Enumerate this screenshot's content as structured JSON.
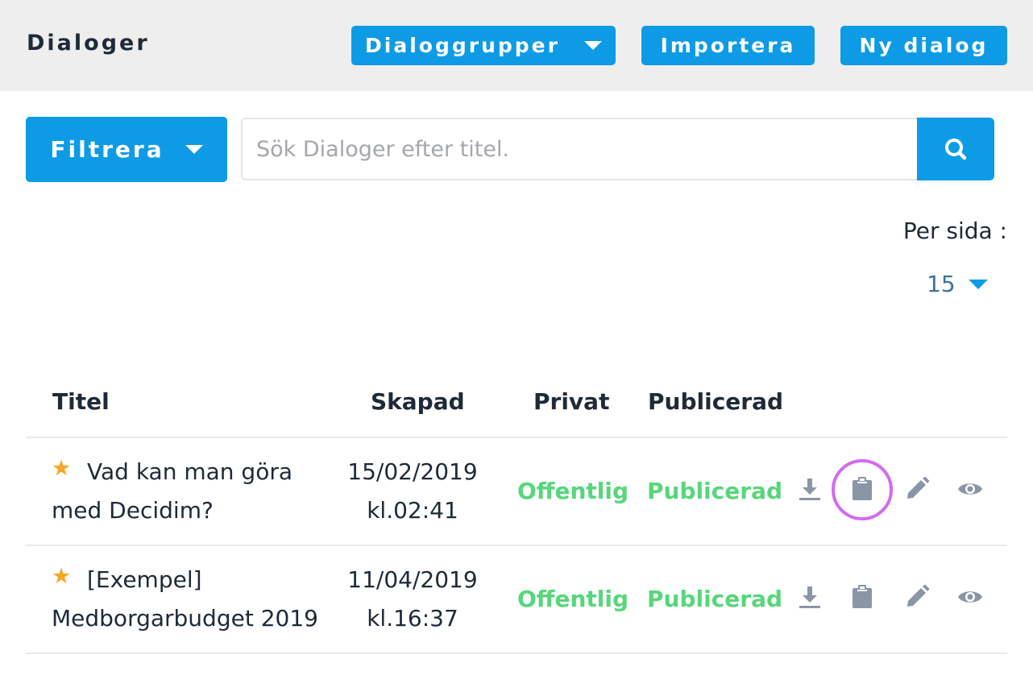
{
  "header": {
    "title": "Dialoger",
    "groups_button": "Dialoggrupper",
    "import_button": "Importera",
    "new_button": "Ny dialog"
  },
  "toolbar": {
    "filter_button": "Filtrera",
    "search_placeholder": "Sök Dialoger efter titel.",
    "search_value": "",
    "search_icon": "search-icon"
  },
  "pagination": {
    "per_page_label": "Per sida :",
    "per_page_value": "15"
  },
  "table": {
    "columns": [
      "Titel",
      "Skapad",
      "Privat",
      "Publicerad"
    ],
    "rows": [
      {
        "title_line1": "Vad kan man göra",
        "title_line2": "med Decidim?",
        "created_date": "15/02/2019",
        "created_time": "kl.02:41",
        "private": "Offentlig",
        "published": "Publicerad",
        "highlighted_action": "copy"
      },
      {
        "title_line1": "[Exempel]",
        "title_line2": "Medborgarbudget 2019",
        "created_date": "11/04/2019",
        "created_time": "kl.16:37",
        "private": "Offentlig",
        "published": "Publicerad",
        "highlighted_action": ""
      }
    ],
    "actions": [
      "download-icon",
      "clipboard-icon",
      "pencil-icon",
      "eye-icon"
    ]
  },
  "colors": {
    "primary": "#0d9be5",
    "success": "#57d67a",
    "star": "#f5a623",
    "icon": "#8a95a6",
    "highlight": "#d36bf0"
  }
}
